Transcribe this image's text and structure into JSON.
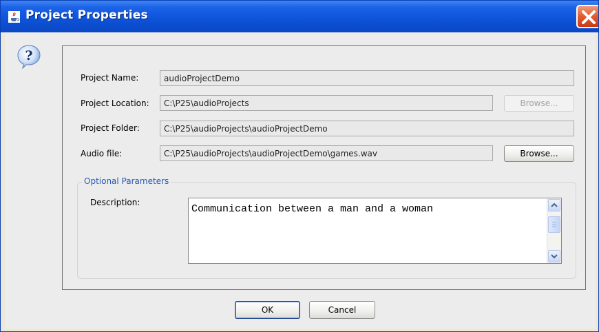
{
  "window": {
    "title": "Project Properties",
    "icon": "java-cup-icon",
    "title_color": "#0a47c4"
  },
  "form": {
    "name": {
      "label": "Project Name:",
      "value": "audioProjectDemo"
    },
    "location": {
      "label": "Project Location:",
      "value": "C:\\P25\\audioProjects",
      "browse_label": "Browse...",
      "browse_enabled": false
    },
    "folder": {
      "label": "Project Folder:",
      "value": "C:\\P25\\audioProjects\\audioProjectDemo"
    },
    "audio": {
      "label": "Audio file:",
      "value": "C:\\P25\\audioProjects\\audioProjectDemo\\games.wav",
      "browse_label": "Browse...",
      "browse_enabled": true
    }
  },
  "optional": {
    "title": "Optional Parameters",
    "description_label": "Description:",
    "description_value": "Communication between a man and a woman"
  },
  "buttons": {
    "ok": "OK",
    "cancel": "Cancel"
  }
}
